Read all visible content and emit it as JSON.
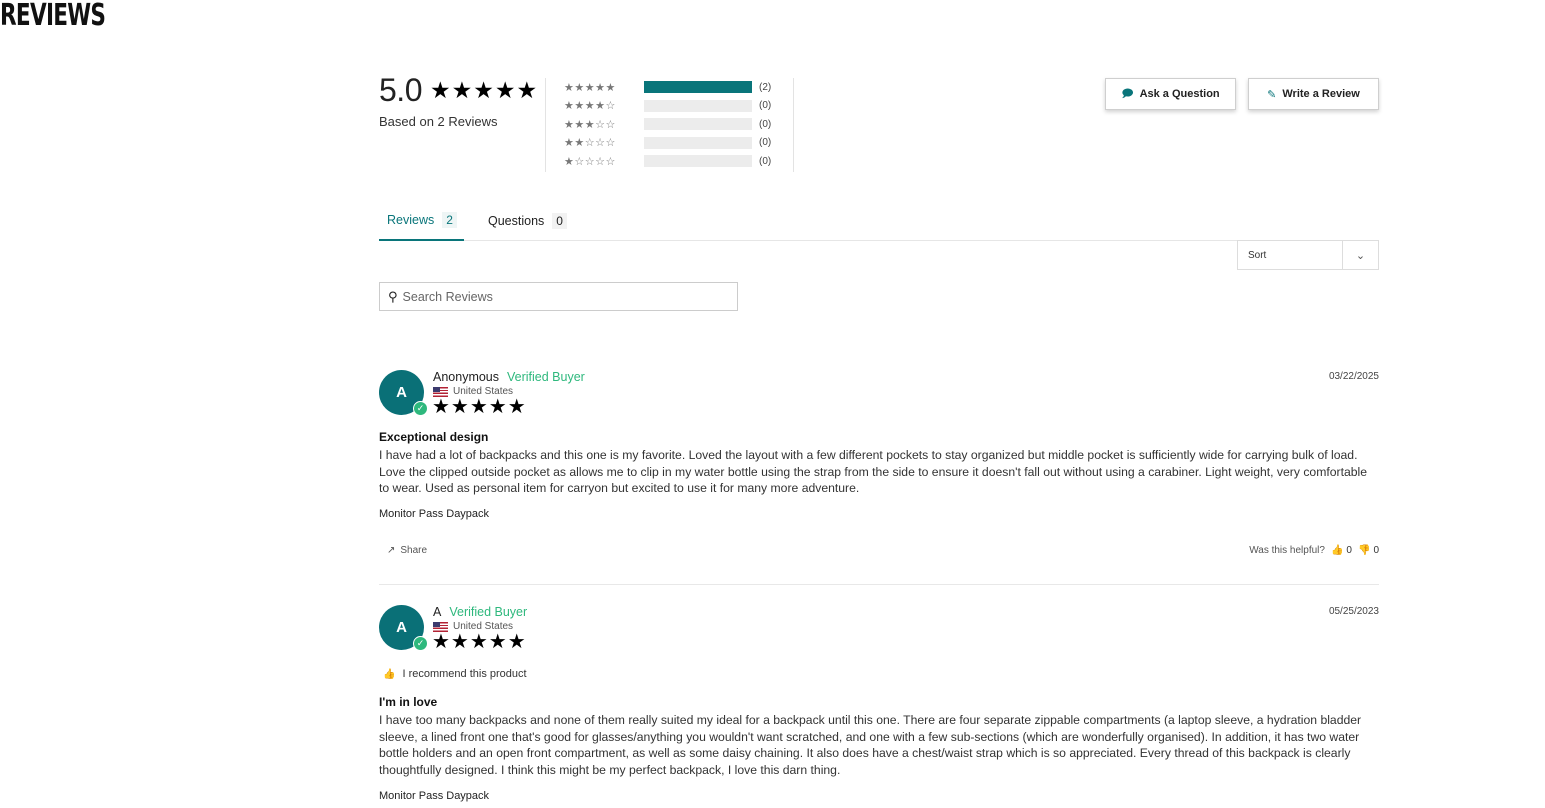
{
  "page": {
    "title": "REVIEWS"
  },
  "summary": {
    "average": "5.0",
    "stars": "★★★★★",
    "based_on": "Based on 2 Reviews",
    "histogram": [
      {
        "stars": "★★★★★",
        "count": "(2)",
        "fraction": 1.0
      },
      {
        "stars": "★★★★☆",
        "count": "(0)",
        "fraction": 0
      },
      {
        "stars": "★★★☆☆",
        "count": "(0)",
        "fraction": 0
      },
      {
        "stars": "★★☆☆☆",
        "count": "(0)",
        "fraction": 0
      },
      {
        "stars": "★☆☆☆☆",
        "count": "(0)",
        "fraction": 0
      }
    ],
    "bar_color": "#09757a"
  },
  "actions": {
    "ask_question": "Ask a Question",
    "write_review": "Write a Review",
    "ask_icon": "chat-bubbles-icon",
    "write_icon": "edit-icon"
  },
  "tabs": [
    {
      "label": "Reviews",
      "count": "2",
      "active": true
    },
    {
      "label": "Questions",
      "count": "0",
      "active": false
    }
  ],
  "sort": {
    "label": "Sort"
  },
  "search": {
    "placeholder": "Search Reviews"
  },
  "reviews": [
    {
      "initial": "A",
      "author": "Anonymous",
      "badge": "Verified Buyer",
      "location": "United States",
      "stars": "★★★★★",
      "date": "03/22/2025",
      "title": "Exceptional design",
      "body": "I have had a lot of backpacks and this one is my favorite. Loved the layout with a few different pockets to stay organized but middle pocket is sufficiently wide for carrying bulk of load. Love the clipped outside pocket as allows me to clip in my water bottle using the strap from the side to ensure it doesn't fall out without using a carabiner. Light weight, very comfortable to wear. Used as personal item for carryon but excited to use it for many more adventure.",
      "product": "Monitor Pass Daypack",
      "share": "Share",
      "helpful_label": "Was this helpful?",
      "up": "0",
      "down": "0"
    },
    {
      "initial": "A",
      "author": "A",
      "badge": "Verified Buyer",
      "location": "United States",
      "stars": "★★★★★",
      "date": "05/25/2023",
      "recommend": "I recommend this product",
      "title": "I'm in love",
      "body": "I have too many backpacks and none of them really suited my ideal for a backpack until this one. There are four separate zippable compartments (a laptop sleeve, a hydration bladder sleeve, a lined front one that's good for glasses/anything you wouldn't want scratched, and one with a few sub-sections (which are wonderfully organised). In addition, it has two water bottle holders and an open front compartment, as well as some daisy chaining. It also does have a chest/waist strap which is so appreciated. Every thread of this backpack is clearly thoughtfully designed. I think this might be my perfect backpack, I love this darn thing.",
      "product": "Monitor Pass Daypack"
    }
  ],
  "colors": {
    "accent": "#09757a",
    "verified": "#2eb87d"
  }
}
